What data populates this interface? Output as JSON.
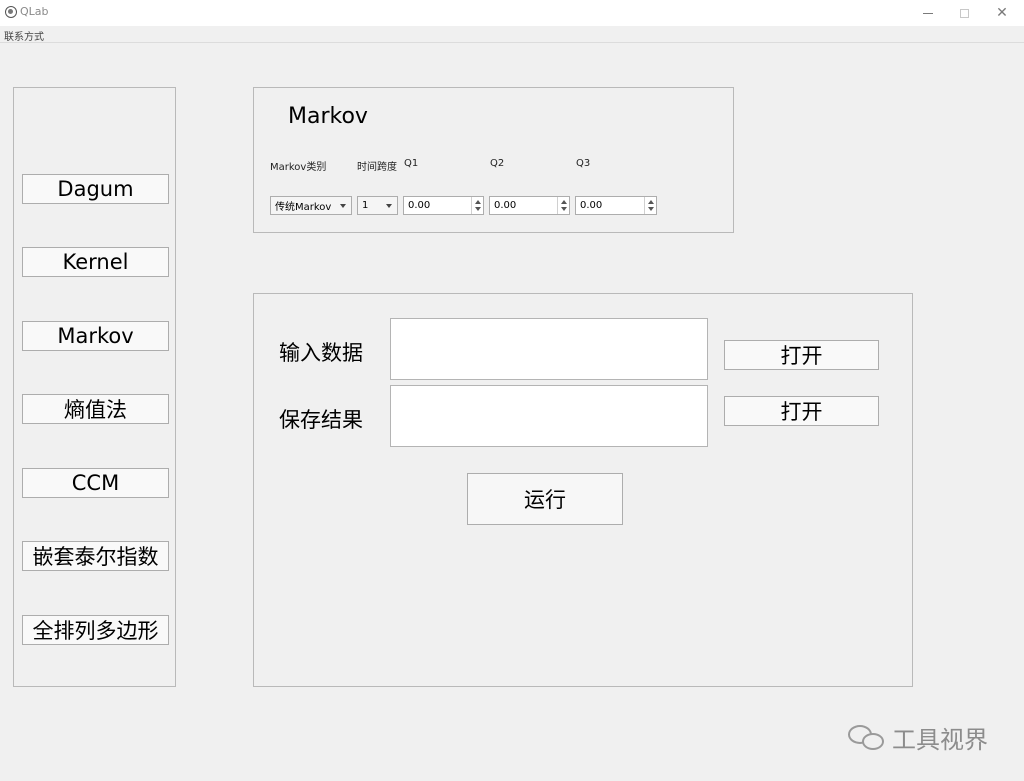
{
  "window": {
    "title": "QLab",
    "minimize": "−",
    "close": "✕"
  },
  "menu": {
    "contact": "联系方式"
  },
  "sidebar": {
    "buttons": [
      "Dagum",
      "Kernel",
      "Markov",
      "熵值法",
      "CCM",
      "嵌套泰尔指数",
      "全排列多边形"
    ]
  },
  "markov_panel": {
    "title": "Markov",
    "labels": {
      "type": "Markov类别",
      "span": "时间跨度",
      "q1": "Q1",
      "q2": "Q2",
      "q3": "Q3"
    },
    "type_value": "传统Markov",
    "span_value": "1",
    "q1_value": "0.00",
    "q2_value": "0.00",
    "q3_value": "0.00"
  },
  "io_panel": {
    "input_label": "输入数据",
    "save_label": "保存结果",
    "input_value": "",
    "save_value": "",
    "open_label_1": "打开",
    "open_label_2": "打开",
    "run_label": "运行"
  },
  "watermark": {
    "text": "工具视界",
    "icon": "wechat-icon"
  }
}
